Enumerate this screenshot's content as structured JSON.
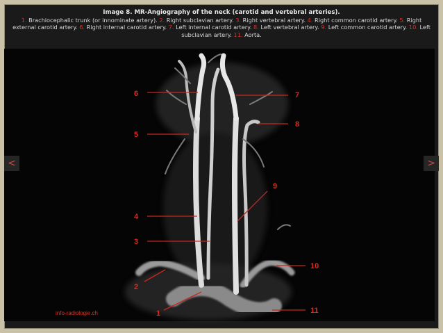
{
  "caption": {
    "title": "Image 8. MR-Angiography of the neck (carotid and vertebral arteries).",
    "items": [
      {
        "num": "1.",
        "text": " Brachiocephalic trunk (or innominate artery). "
      },
      {
        "num": "2.",
        "text": " Right subclavian artery. "
      },
      {
        "num": "3.",
        "text": " Right vertebral artery. "
      },
      {
        "num": "4.",
        "text": " Right common carotid artery. "
      },
      {
        "num": "5.",
        "text": " Right external carotid artery. "
      },
      {
        "num": "6.",
        "text": " Right internal carotid artery. "
      },
      {
        "num": "7.",
        "text": " Left internal carotid artery. "
      },
      {
        "num": "8.",
        "text": " Left vertebral artery. "
      },
      {
        "num": "9.",
        "text": " Left common carotid artery. "
      },
      {
        "num": "10.",
        "text": " Left subclavian artery. "
      },
      {
        "num": "11.",
        "text": " Aorta."
      }
    ]
  },
  "labels": [
    "6",
    "7",
    "8",
    "5",
    "9",
    "4",
    "3",
    "10",
    "2",
    "1",
    "11"
  ],
  "watermark": "info-radiologie.ch",
  "nav": {
    "prev": "<",
    "next": ">"
  },
  "colors": {
    "label": "#e0281e",
    "background": "#050505",
    "frame": "#c9c2a8"
  }
}
